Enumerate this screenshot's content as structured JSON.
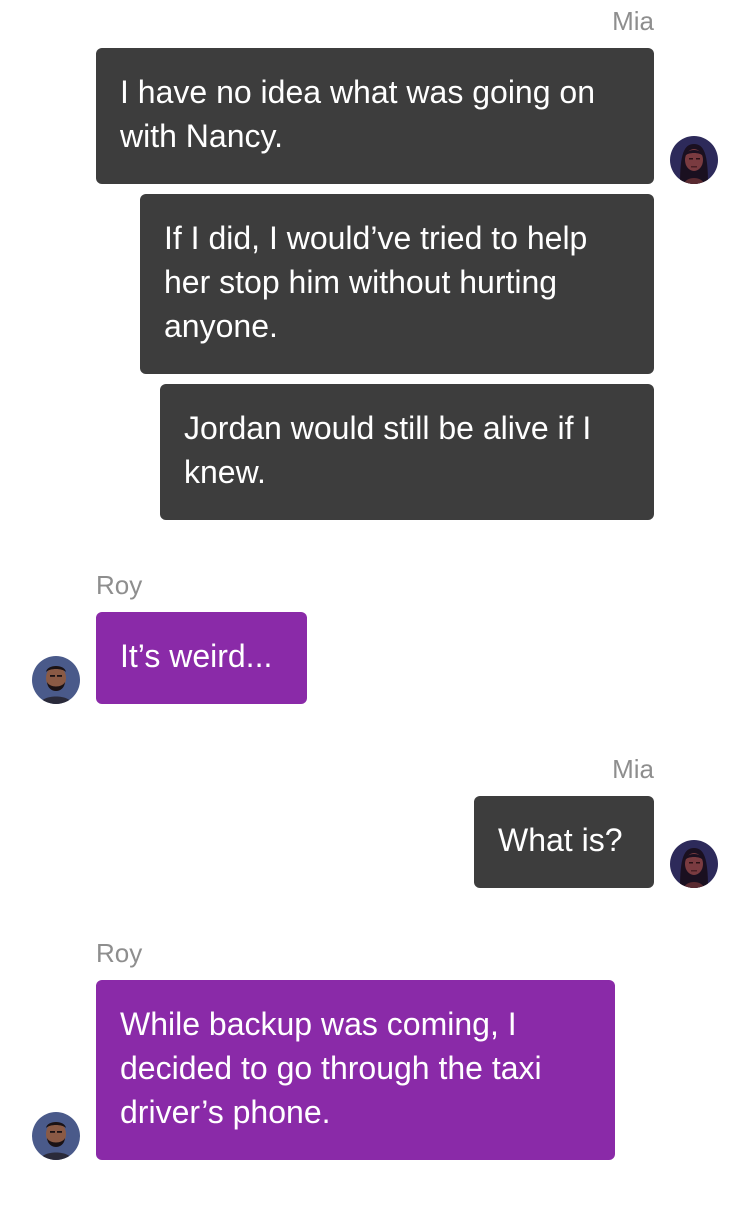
{
  "conversation": {
    "messages": [
      {
        "sender": "Mia",
        "text": "I have no idea what was going on with Nancy."
      },
      {
        "text": "If I did, I would’ve tried to help her stop him without hurting anyone."
      },
      {
        "text": "Jordan would still be alive if I knew."
      },
      {
        "sender": "Roy",
        "text": "It’s weird..."
      },
      {
        "sender": "Mia",
        "text": "What is?"
      },
      {
        "sender": "Roy",
        "text": "While backup was coming, I decided to go through the taxi driver’s phone."
      }
    ]
  },
  "colors": {
    "mia_bubble": "#3d3d3d",
    "roy_bubble": "#8a2aa8",
    "sender_label": "#8e8e8e"
  },
  "icons": {
    "mia_avatar": "woman-portrait-icon",
    "roy_avatar": "bearded-man-portrait-icon"
  }
}
